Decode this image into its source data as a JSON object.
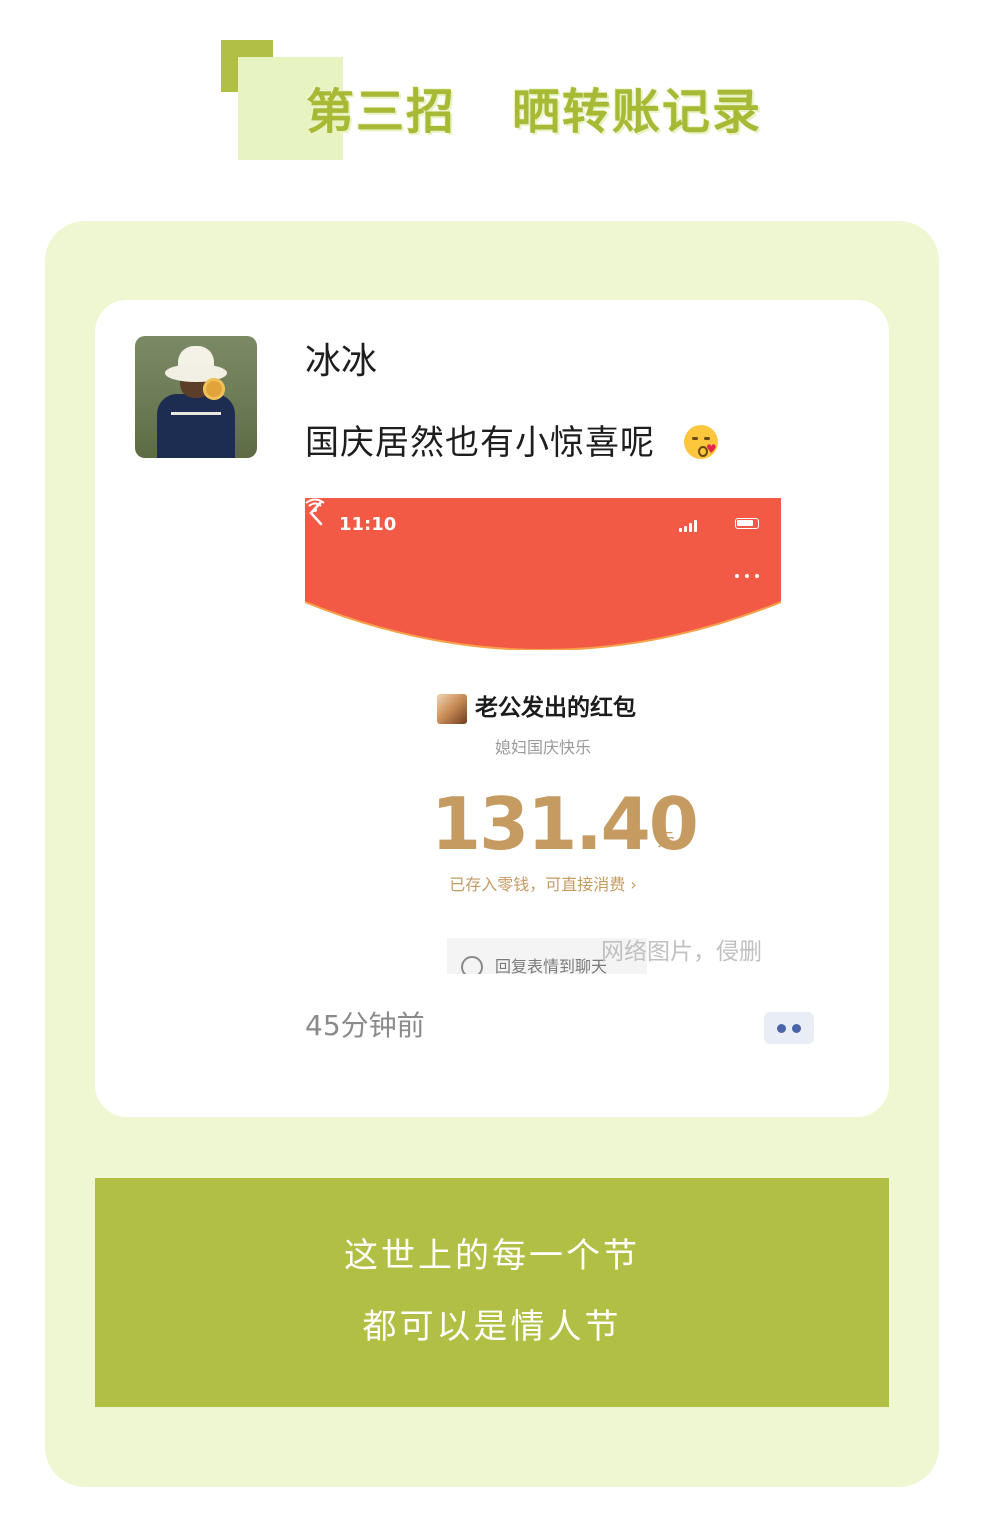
{
  "header": {
    "title_part1": "第三招",
    "title_part2": "晒转账记录"
  },
  "post": {
    "user_name": "冰冰",
    "text": "国庆居然也有小惊喜呢",
    "emoji": "kissing-face-with-heart",
    "timestamp": "45分钟前"
  },
  "screenshot": {
    "status_time": "11:10",
    "sender_title": "老公发出的红包",
    "greeting": "媳妇国庆快乐",
    "amount": "131.40",
    "unit": "元",
    "deposit_note": "已存入零钱，可直接消费 ›",
    "reply_hint": "回复表情到聊天",
    "watermark": "网络图片，侵删"
  },
  "quote": {
    "line1": "这世上的每一个节",
    "line2": "都可以是情人节"
  },
  "colors": {
    "accent_green": "#b2bf45",
    "panel_bg": "#eef7d2",
    "red_packet": "#f35a45",
    "gold_text": "#c69b62"
  }
}
